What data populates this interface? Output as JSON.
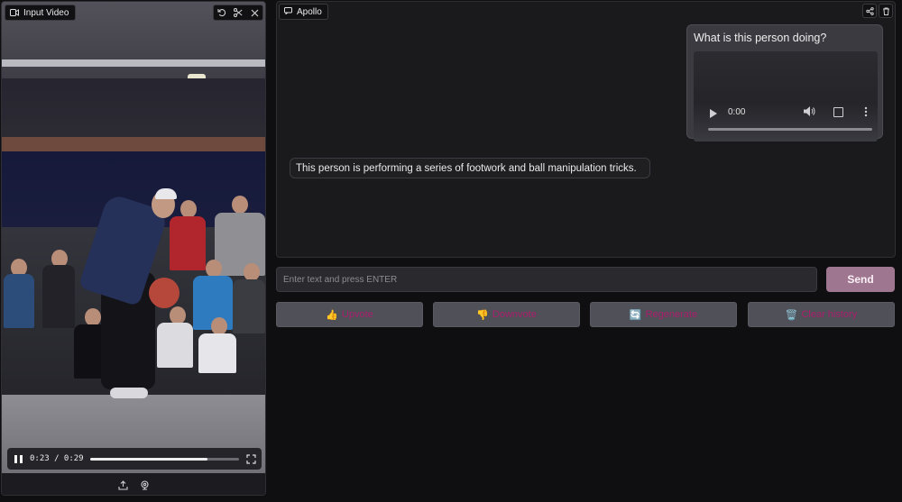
{
  "video_panel": {
    "label": "Input Video",
    "controls": {
      "time": "0:23 / 0:29",
      "progress": 0.79
    },
    "icons": [
      "video-icon",
      "undo-icon",
      "scissors-icon",
      "close-icon",
      "pause-icon",
      "fullscreen-icon",
      "upload-icon",
      "webcam-icon"
    ]
  },
  "chat": {
    "label": "Apollo",
    "user_message": {
      "text": "What is this person doing?",
      "video_time": "0:00"
    },
    "bot_message": {
      "text": "This person is performing a series of footwork and ball manipulation tricks."
    }
  },
  "input": {
    "placeholder": "Enter text and press ENTER",
    "value": ""
  },
  "send_label": "Send",
  "actions": [
    {
      "emoji": "👍",
      "label": "Upvote"
    },
    {
      "emoji": "👎",
      "label": "Downvote"
    },
    {
      "emoji": "🔄",
      "label": "Regenerate"
    },
    {
      "emoji": "🗑️",
      "label": "Clear history"
    }
  ],
  "colors": {
    "accent": "#9e7690",
    "action_text": "#a91d6b",
    "background": "#0f0f11"
  }
}
